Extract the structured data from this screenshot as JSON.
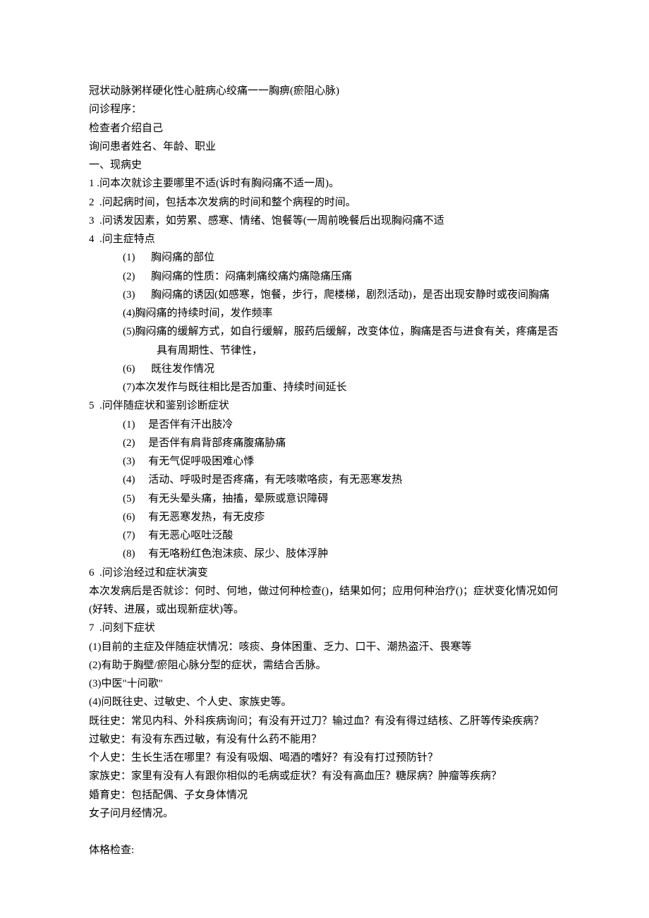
{
  "title": "冠状动脉粥样硬化性心脏病心绞痛一一胸痹(瘀阻心脉)",
  "proc_label": "问诊程序：",
  "intro_self": "检查者介绍自己",
  "ask_patient": "询问患者姓名、年龄、职业",
  "sec1_title": "一、现病史",
  "q1": "1 .问本次就诊主要哪里不适(诉时有胸闷痛不适一周)。",
  "q2": "2  .问起病时间，包括本次发病的时间和整个病程的时间。",
  "q3": "3  .问诱发因素，如劳累、感寒、情绪、饱餐等(一周前晚餐后出现胸闷痛不适",
  "q4": "4  .问主症特点",
  "q4_1": "(1)      胸闷痛的部位",
  "q4_2": "(2)      胸闷痛的性质：闷痛刺痛绞痛灼痛隐痛压痛",
  "q4_3": "(3)      胸闷痛的诱因(如感寒，饱餐，步行，爬楼梯，剧烈活动)，是否出现安静时或夜间胸痛",
  "q4_4": "(4)胸闷痛的持续时间，发作频率",
  "q4_5": "(5)胸闷痛的缓解方式，如自行缓解，服药后缓解，改变体位，胸痛是否与进食有关，疼痛是否具有周期性、节律性，",
  "q4_6": "(6)      既往发作情况",
  "q4_7": "(7)本次发作与既往相比是否加重、持续时间延长",
  "q5": "5  .问伴随症状和鉴别诊断症状",
  "q5_1": "(1)     是否伴有汗出肢冷",
  "q5_2": "(2)     是否伴有肩背部疼痛腹痛胁痛",
  "q5_3": "(3)     有无气促呼吸困难心悸",
  "q5_4": "(4)     活动、呼吸时是否疼痛，有无咳嗽咯痰，有无恶寒发热",
  "q5_5": "(5)     有无头晕头痛，抽搐，晕厥或意识障碍",
  "q5_6": "(6)     有无恶寒发热，有无皮疹",
  "q5_7": "(7)     有无恶心呕吐泛酸",
  "q5_8": "(8)     有无咯粉红色泡沫痰、尿少、肢体浮肿",
  "q6": "6  .问诊治经过和症状演变",
  "q6_body": "本次发病后是否就诊：何时、何地，做过何种检查()，结果如何；应用何种治疗()；症状变化情况如何(好转、进展，或出现新症状)等。",
  "q7": "7  .问刻下症状",
  "q7_1": "(1)目前的主症及伴随症状情况：咳痰、身体困重、乏力、口干、潮热盗汗、畏寒等",
  "q7_2": "(2)有助于胸壁/瘀阻心脉分型的症状，需结合舌脉。",
  "q7_3": "(3)中医\"十问歌\"",
  "q7_4": "(4)问既往史、过敏史、个人史、家族史等。",
  "hist_past": "既往史：常见内科、外科疾病询问；有没有开过刀？输过血？有没有得过结核、乙肝等传染疾病？",
  "hist_allergy": "过敏史：有没有东西过敏，有没有什么药不能用？",
  "hist_personal": "个人史：生长生活在哪里？有没有吸烟、喝酒的嗜好？有没有打过预防针？",
  "hist_family": "家族史：家里有没有人有跟你相似的毛病或症状？有没有高血压？糖尿病？肿瘤等疾病？",
  "hist_marriage": "婚育史：包括配偶、子女身体情况",
  "hist_menses": "女子问月经情况。",
  "exam_label": "体格检查:"
}
